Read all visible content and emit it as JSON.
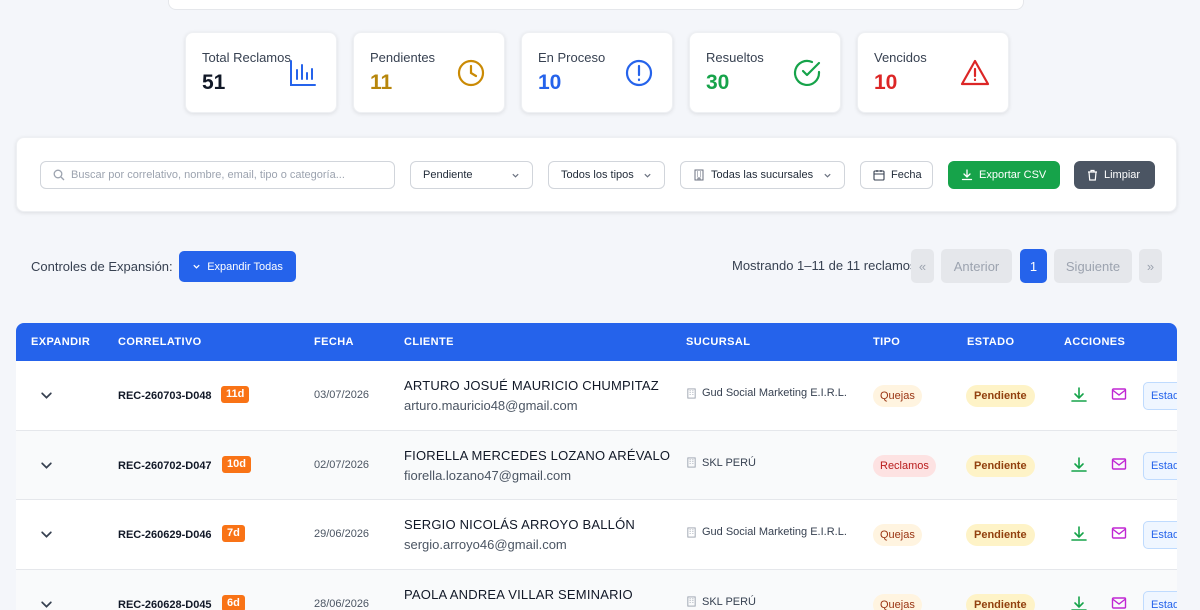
{
  "stats": [
    {
      "label": "Total Reclamos",
      "value": "51",
      "color": "#111827",
      "icon": "bar-chart-icon"
    },
    {
      "label": "Pendientes",
      "value": "11",
      "color": "#b7860b",
      "icon": "clock-icon"
    },
    {
      "label": "En Proceso",
      "value": "10",
      "color": "#2563eb",
      "icon": "alert-circle-icon"
    },
    {
      "label": "Resueltos",
      "value": "30",
      "color": "#16a34a",
      "icon": "check-circle-icon"
    },
    {
      "label": "Vencidos",
      "value": "10",
      "color": "#dc2626",
      "icon": "warning-triangle-icon"
    }
  ],
  "filters": {
    "search_placeholder": "Buscar por correlativo, nombre, email, tipo o categoría...",
    "estado": "Pendiente",
    "tipo": "Todos los tipos",
    "sucursal": "Todas las sucursales",
    "fecha": "Fecha",
    "export": "Exportar CSV",
    "clear": "Limpiar"
  },
  "expansion": {
    "label": "Controles de Expansión:",
    "button": "Expandir Todas"
  },
  "pagination": {
    "showing": "Mostrando 1–11 de 11 reclamos",
    "first": "«",
    "prev": "Anterior",
    "current": "1",
    "next": "Siguiente",
    "last": "»"
  },
  "table": {
    "headers": [
      "EXPANDIR",
      "CORRELATIVO",
      "FECHA",
      "CLIENTE",
      "SUCURSAL",
      "TIPO",
      "ESTADO",
      "ACCIONES"
    ],
    "rows": [
      {
        "correlativo": "REC-260703-D048",
        "days": "11d",
        "fecha": "03/07/2026",
        "nombre": "ARTURO JOSUÉ MAURICIO CHUMPITAZ",
        "email": "arturo.mauricio48@gmail.com",
        "sucursal": "Gud Social Marketing E.I.R.L.",
        "tipo": "Quejas",
        "estado": "Pendiente",
        "estado_btn": "Estado"
      },
      {
        "correlativo": "REC-260702-D047",
        "days": "10d",
        "fecha": "02/07/2026",
        "nombre": "FIORELLA MERCEDES LOZANO ARÉVALO",
        "email": "fiorella.lozano47@gmail.com",
        "sucursal": "SKL PERÚ",
        "tipo": "Reclamos",
        "estado": "Pendiente",
        "estado_btn": "Estado"
      },
      {
        "correlativo": "REC-260629-D046",
        "days": "7d",
        "fecha": "29/06/2026",
        "nombre": "SERGIO NICOLÁS ARROYO BALLÓN",
        "email": "sergio.arroyo46@gmail.com",
        "sucursal": "Gud Social Marketing E.I.R.L.",
        "tipo": "Quejas",
        "estado": "Pendiente",
        "estado_btn": "Estado"
      },
      {
        "correlativo": "REC-260628-D045",
        "days": "6d",
        "fecha": "28/06/2026",
        "nombre": "PAOLA ANDREA VILLAR SEMINARIO",
        "email": "",
        "sucursal": "SKL PERÚ",
        "tipo": "Quejas",
        "estado": "Pendiente",
        "estado_btn": "Estado"
      }
    ]
  }
}
